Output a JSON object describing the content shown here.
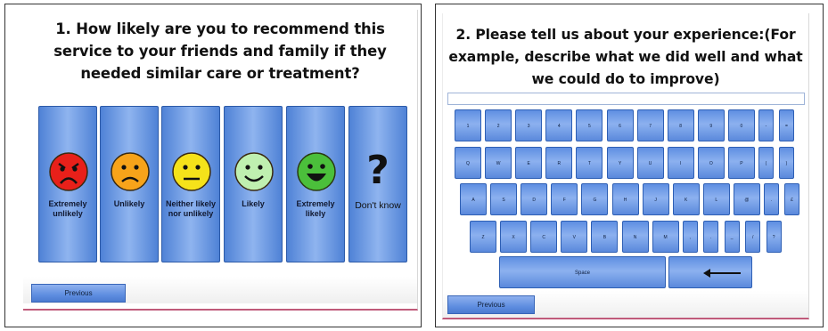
{
  "q1": {
    "title": "1. How likely are you to recommend this service to your friends and family if they needed similar care or treatment?",
    "options": [
      {
        "label": "Extremely unlikely",
        "face": "very-sad-face-icon",
        "color": "#e8201a"
      },
      {
        "label": "Unlikely",
        "face": "sad-face-icon",
        "color": "#f7a31a"
      },
      {
        "label": "Neither likely nor unlikely",
        "face": "neutral-face-icon",
        "color": "#f5e21a"
      },
      {
        "label": "Likely",
        "face": "smile-face-icon",
        "color": "#bff0b0"
      },
      {
        "label": "Extremely likely",
        "face": "big-smile-face-icon",
        "color": "#4bbf3b"
      },
      {
        "label": "Don't know",
        "face": "question-mark-icon",
        "color": "#111111"
      }
    ],
    "previous_label": "Previous"
  },
  "q2": {
    "title": "2. Please tell us about your experience:(For example, describe what we did well and what we could do to improve)",
    "input_value": "",
    "keyboard": {
      "row1": [
        "1",
        "2",
        "3",
        "4",
        "5",
        "6",
        "7",
        "8",
        "9",
        "0",
        "-",
        "="
      ],
      "row2": [
        "Q",
        "W",
        "E",
        "R",
        "T",
        "Y",
        "U",
        "I",
        "O",
        "P",
        "(",
        ")"
      ],
      "row3": [
        "A",
        "S",
        "D",
        "F",
        "G",
        "H",
        "J",
        "K",
        "L",
        "@",
        ".",
        "£"
      ],
      "row4": [
        "Z",
        "X",
        "C",
        "V",
        "B",
        "N",
        "M",
        ",",
        ".",
        "_",
        "/",
        "?"
      ],
      "space_label": "Space",
      "backspace_icon": "left-arrow-icon"
    },
    "previous_label": "Previous"
  },
  "colors": {
    "button_blue": "#6f9be6",
    "border_blue": "#2c5aa8",
    "accent_line": "#c05a7a"
  }
}
